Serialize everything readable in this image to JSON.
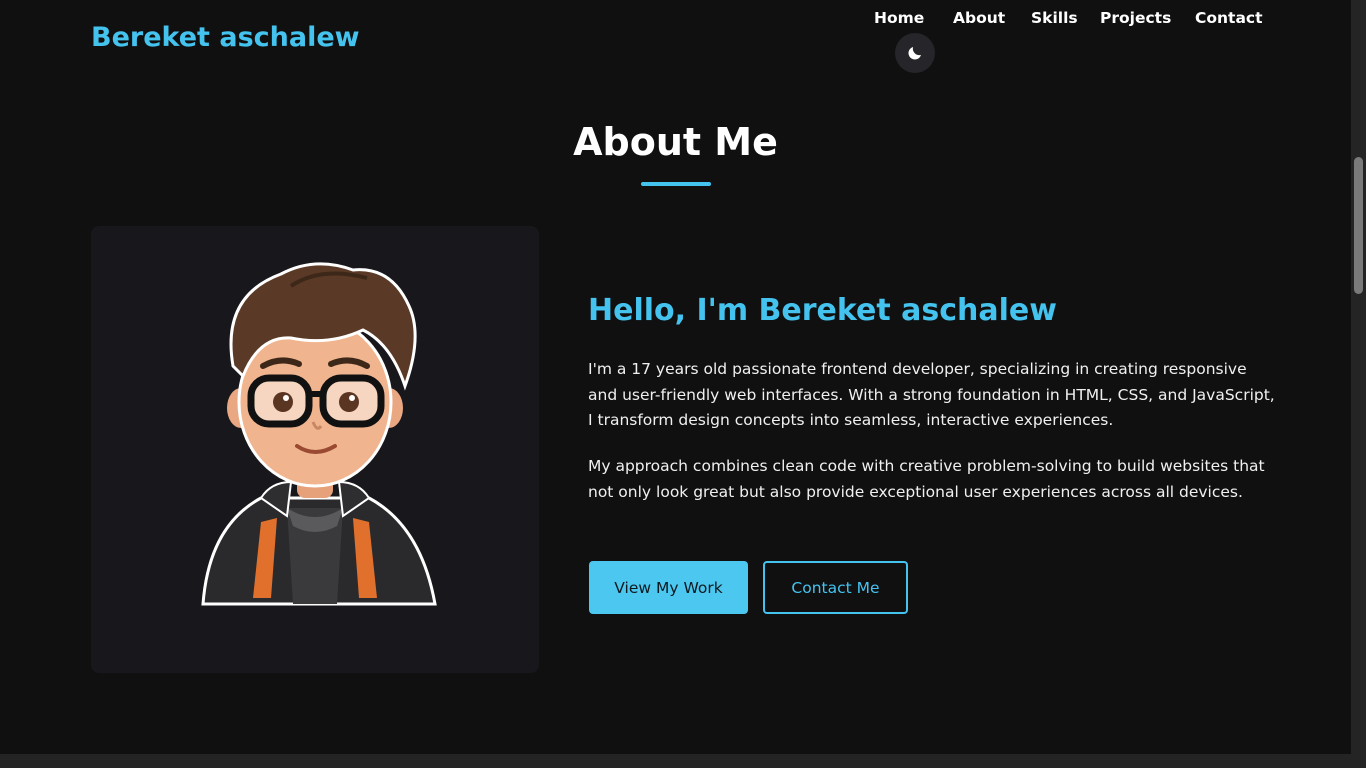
{
  "header": {
    "logo": "Bereket aschalew",
    "nav": [
      {
        "label": "Home"
      },
      {
        "label": "About"
      },
      {
        "label": "Skills"
      },
      {
        "label": "Projects"
      },
      {
        "label": "Contact"
      }
    ],
    "theme_toggle_icon": "moon-icon"
  },
  "about": {
    "title": "About Me",
    "greeting": "Hello, I'm Bereket aschalew",
    "paragraph1": "I'm a 17 years old passionate frontend developer, specializing in creating responsive and user-friendly web interfaces. With a strong foundation in HTML, CSS, and JavaScript, I transform design concepts into seamless, interactive experiences.",
    "paragraph2": "My approach combines clean code with creative problem-solving to build websites that not only look great but also provide exceptional user experiences across all devices.",
    "primary_button": "View My Work",
    "secondary_button": "Contact Me",
    "avatar_icon": "cartoon-avatar-illustration"
  },
  "colors": {
    "accent": "#45c3ef",
    "background": "#101011",
    "card": "#17171c"
  }
}
